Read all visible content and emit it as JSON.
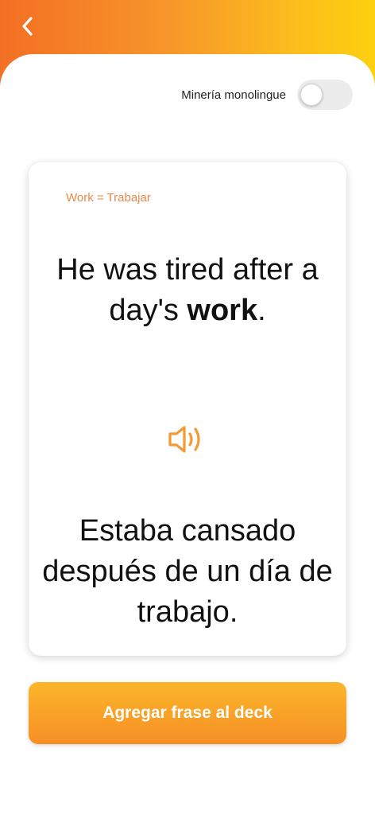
{
  "header": {
    "back_icon": "chevron-left-icon"
  },
  "toggle": {
    "label": "Minería monolingue",
    "state": "off"
  },
  "card": {
    "hint": "Work = Trabajar",
    "sentence_en": {
      "before": "He was tired after a day's ",
      "highlight": "work",
      "after": "."
    },
    "audio_icon": "speaker-icon",
    "sentence_es": "Estaba cansado después de un día de trabajo."
  },
  "action": {
    "label": "Agregar frase al deck"
  },
  "colors": {
    "accent": "#f7962a",
    "hint": "#e9894a",
    "text": "#111111"
  }
}
